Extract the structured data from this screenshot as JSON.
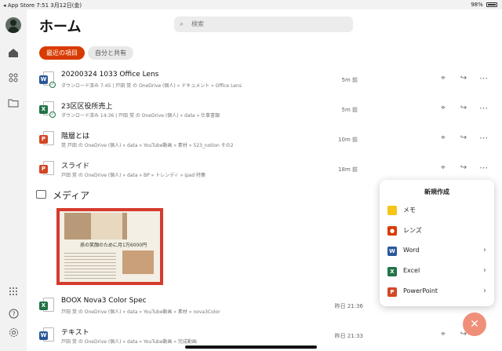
{
  "status_bar": {
    "left": "◂ App Store  7:51  3月12日(金)",
    "right": "98%"
  },
  "header": {
    "title": "ホーム",
    "search_placeholder": "検索"
  },
  "filters": [
    {
      "label": "最近の項目",
      "active": true
    },
    {
      "label": "自分と共有",
      "active": false
    }
  ],
  "files": [
    {
      "type": "word",
      "name": "20200324 1033 Office Lens",
      "path": "ダウンロード済み 7:45 | 戸田 覚 の OneDrive (個人) » ドキュメント » Office Lens",
      "time": "5m 前",
      "synced": true
    },
    {
      "type": "excel",
      "name": "23区区役所売上",
      "path": "ダウンロード済み 14:36 | 戸田 覚 の OneDrive (個人) » data » 仕事書類",
      "time": "5m 前",
      "synced": true
    },
    {
      "type": "powerpoint",
      "name": "階層とは",
      "path": "覚 戸田 の OneDrive (個人) » data » YouTube動画 » 素材 » 523_notion その2",
      "time": "10m 前",
      "synced": false
    },
    {
      "type": "powerpoint",
      "name": "スライド",
      "path": "戸田 覚 の OneDrive (個人) » data » BP » トレンディ » ipad 特集",
      "time": "18m 前",
      "synced": false
    }
  ],
  "media": {
    "heading": "メディア",
    "thumbnail_caption": "孫の笑顔のために月1万6000円"
  },
  "files_bottom": [
    {
      "type": "excel",
      "name": "BOOX Nova3 Color Spec",
      "path": "戸田 覚 の OneDrive (個人) » data » YouTube動画 » 素材 » nova3Color",
      "time": "昨日 21:36"
    },
    {
      "type": "word",
      "name": "テキスト",
      "path": "戸田 覚 の OneDrive (個人) » data » YouTube動画 » 完成動画",
      "time": "昨日 21:33"
    }
  ],
  "new_menu": {
    "title": "新規作成",
    "items": [
      {
        "label": "メモ",
        "icon": "note-icon",
        "color": "#f5c518",
        "has_chevron": false
      },
      {
        "label": "レンズ",
        "icon": "lens-icon",
        "color": "#d83b01",
        "has_chevron": false
      },
      {
        "label": "Word",
        "icon": "word-icon",
        "color": "#2b579a",
        "has_chevron": true
      },
      {
        "label": "Excel",
        "icon": "excel-icon",
        "color": "#217346",
        "has_chevron": true
      },
      {
        "label": "PowerPoint",
        "icon": "powerpoint-icon",
        "color": "#d24726",
        "has_chevron": true
      }
    ]
  },
  "fab_icon": "close-icon",
  "colors": {
    "accent": "#d83b01"
  }
}
